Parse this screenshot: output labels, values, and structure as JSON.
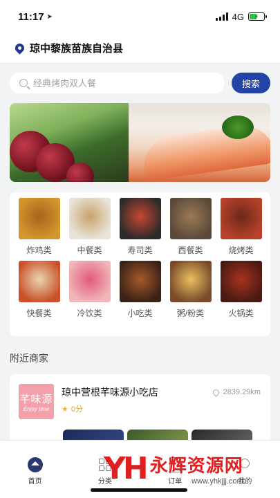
{
  "status_bar": {
    "time": "11:17",
    "network": "4G"
  },
  "location": {
    "name": "琼中黎族苗族自治县"
  },
  "search": {
    "placeholder": "经典烤肉双人餐",
    "button_label": "搜索"
  },
  "categories": [
    {
      "label": "炸鸡类",
      "colors": [
        "#d4962e",
        "#a8631a"
      ]
    },
    {
      "label": "中餐类",
      "colors": [
        "#e8e4da",
        "#c9a36a"
      ]
    },
    {
      "label": "寿司类",
      "colors": [
        "#2b2b2b",
        "#c8462f"
      ]
    },
    {
      "label": "西餐类",
      "colors": [
        "#5a4a3a",
        "#9b7a55"
      ]
    },
    {
      "label": "烧烤类",
      "colors": [
        "#b8412a",
        "#6a2a1a"
      ]
    },
    {
      "label": "快餐类",
      "colors": [
        "#c9502a",
        "#e9d6b0"
      ]
    },
    {
      "label": "冷饮类",
      "colors": [
        "#f1b6b8",
        "#e05a7a"
      ]
    },
    {
      "label": "小吃类",
      "colors": [
        "#3a2218",
        "#a65a28"
      ]
    },
    {
      "label": "粥/粉类",
      "colors": [
        "#7a4a2a",
        "#e8c060"
      ]
    },
    {
      "label": "火锅类",
      "colors": [
        "#4a1a14",
        "#a8331f"
      ]
    }
  ],
  "nearby": {
    "title": "附近商家",
    "merchant": {
      "name": "琼中营根芊味源小吃店",
      "rating": "0分",
      "distance": "2839.29km",
      "logo_text": "芊味源",
      "logo_sub": "Enjoy time"
    }
  },
  "tabs": [
    {
      "label": "首页",
      "icon": "home-icon"
    },
    {
      "label": "分类",
      "icon": "grid-icon"
    },
    {
      "label": "订单",
      "icon": "doc-icon"
    },
    {
      "label": "我的",
      "icon": "user-icon"
    }
  ],
  "watermark": {
    "logo": "YH",
    "title": "永辉资源网",
    "url": "www.yhkjjj.com"
  },
  "colors": {
    "accent": "#2343a6",
    "brand_red": "#e02020",
    "star": "#f0b429"
  }
}
